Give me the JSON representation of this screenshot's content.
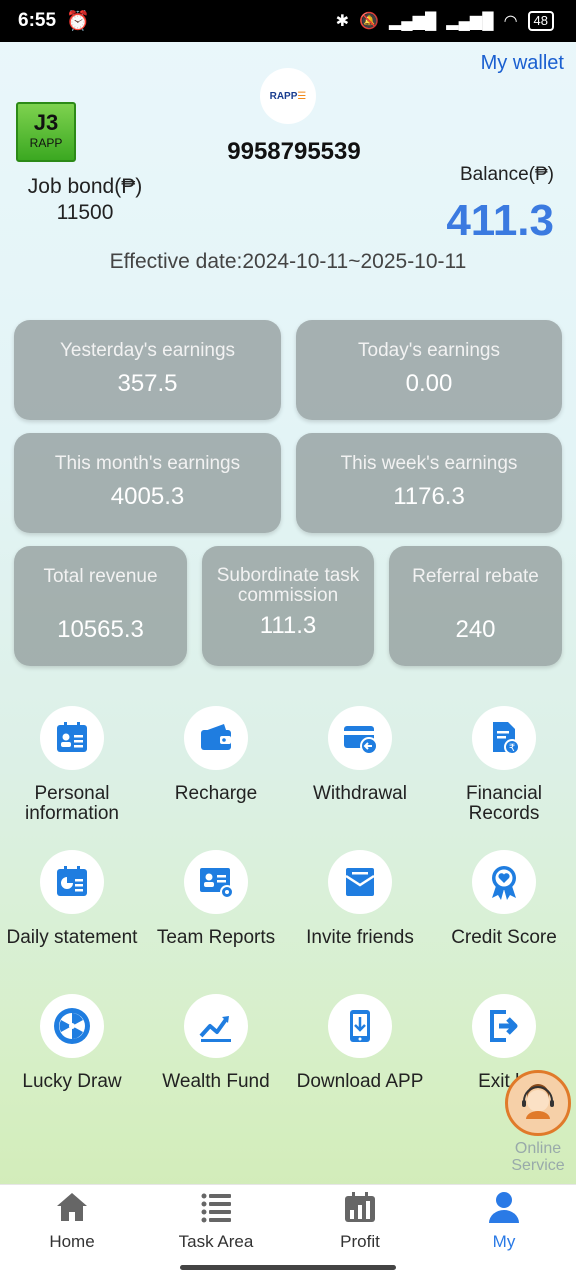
{
  "status_bar": {
    "time": "6:55",
    "battery": "48"
  },
  "header": {
    "wallet_link": "My wallet",
    "logo_text": "RAPP",
    "level": "J3",
    "level_brand": "RAPP",
    "phone": "9958795539",
    "bond_label": "Job bond(₱)",
    "bond_value": "11500",
    "balance_label": "Balance(₱)",
    "balance_value": "411.3",
    "effective": "Effective date:2024-10-11~2025-10-11"
  },
  "cards": [
    {
      "label": "Yesterday's earnings",
      "value": "357.5"
    },
    {
      "label": "Today's earnings",
      "value": "0.00"
    },
    {
      "label": "This month's earnings",
      "value": "4005.3"
    },
    {
      "label": "This week's earnings",
      "value": "1176.3"
    },
    {
      "label": "Total revenue",
      "value": "10565.3"
    },
    {
      "label": "Subordinate task commission",
      "value": "111.3"
    },
    {
      "label": "Referral rebate",
      "value": "240"
    }
  ],
  "menu": [
    {
      "label": "Personal information",
      "icon": "id-card-icon"
    },
    {
      "label": "Recharge",
      "icon": "wallet-icon"
    },
    {
      "label": "Withdrawal",
      "icon": "card-withdraw-icon"
    },
    {
      "label": "Financial Records",
      "icon": "document-rupee-icon"
    },
    {
      "label": "Daily statement",
      "icon": "calendar-chart-icon"
    },
    {
      "label": "Team Reports",
      "icon": "team-report-icon"
    },
    {
      "label": "Invite friends",
      "icon": "mail-icon"
    },
    {
      "label": "Credit Score",
      "icon": "ribbon-heart-icon"
    },
    {
      "label": "Lucky Draw",
      "icon": "wheel-icon"
    },
    {
      "label": "Wealth Fund",
      "icon": "trend-chart-icon"
    },
    {
      "label": "Download APP",
      "icon": "phone-download-icon"
    },
    {
      "label": "Exit lo",
      "icon": "exit-icon"
    }
  ],
  "support": {
    "label": "Online Service"
  },
  "tabs": [
    {
      "label": "Home",
      "icon": "home-icon"
    },
    {
      "label": "Task Area",
      "icon": "list-icon"
    },
    {
      "label": "Profit",
      "icon": "profit-icon"
    },
    {
      "label": "My",
      "icon": "user-icon"
    }
  ],
  "colors": {
    "accent": "#2a7ae6",
    "balance": "#3b7ae0",
    "card_bg": "#8c9696",
    "icon_blue": "#1f7de0"
  }
}
